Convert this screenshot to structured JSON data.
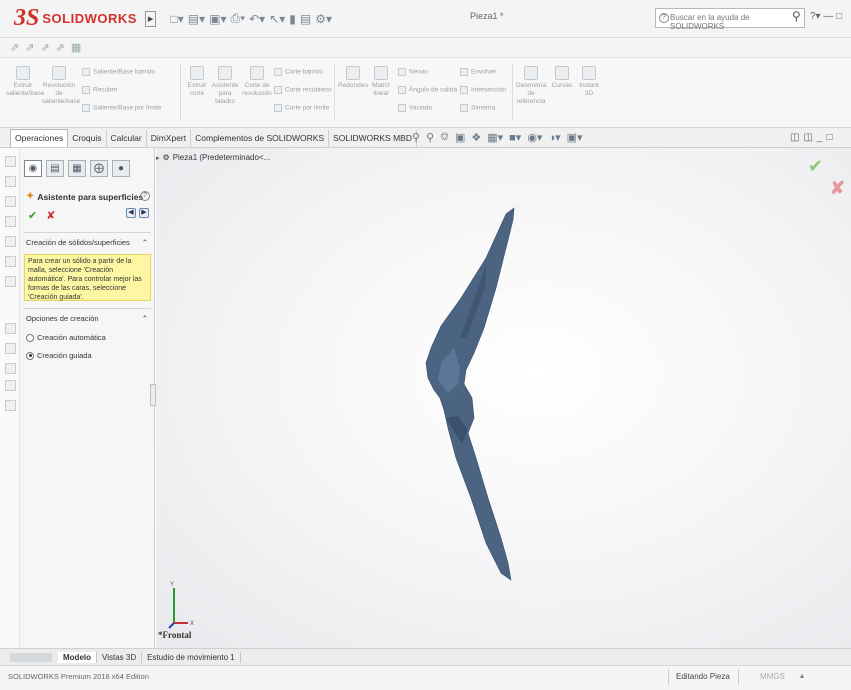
{
  "app": {
    "logo_ds": "3S",
    "logo_text": "SOLIDWORKS",
    "document_title": "Pieza1 *"
  },
  "help": {
    "search_placeholder": "Buscar en la ayuda de SOLIDWORKS"
  },
  "ribbon": {
    "items": {
      "extruir_saliente": "Extruir saliente/base",
      "revolucion_saliente": "Revolución de saliente/base",
      "saliente_barrido": "Saliente/Base barrido",
      "recubrir": "Recubrir",
      "saliente_limite": "Saliente/Base por límite",
      "extruir_corte": "Extruir corte",
      "asistente_taladro": "Asistente para taladro",
      "corte_revolucion": "Corte de revolución",
      "corte_barrido": "Corte barrido",
      "corte_recubierto": "Corte recubierto",
      "corte_limite": "Corte por límite",
      "redondeo": "Redondeo",
      "matriz_lineal": "Matriz lineal",
      "nervio": "Nervio",
      "angulo_salida": "Ángulo de salida",
      "vaciado": "Vaciado",
      "envolver": "Envolver",
      "interseccion": "Intersección",
      "simetria": "Simetría",
      "geometria_referencia": "Geometría de referencia",
      "curvas": "Curvas",
      "instant3d": "Instant 3D"
    }
  },
  "tabs": [
    {
      "label": "Operaciones"
    },
    {
      "label": "Croquis"
    },
    {
      "label": "Calcular"
    },
    {
      "label": "DimXpert"
    },
    {
      "label": "Complementos de SOLIDWORKS"
    },
    {
      "label": "SOLIDWORKS MBD"
    }
  ],
  "property_manager": {
    "title": "Asistente para superficies",
    "group1_title": "Creación de sólidos/superficies",
    "message": "Para crear un sólido a partir de la malla, seleccione 'Creación automática'. Para controlar mejor las formas de las caras, seleccione 'Creación guiada'.",
    "group2_title": "Opciones de creación",
    "option_auto": "Creación automática",
    "option_guided": "Creación guiada",
    "selected_option": "Creación guiada"
  },
  "viewport": {
    "tree_root": "Pieza1  (Predeterminado<...",
    "view_label": "*Frontal"
  },
  "bottom_tabs": [
    {
      "label": "Modelo"
    },
    {
      "label": "Vistas 3D"
    },
    {
      "label": "Estudio de movimiento 1"
    }
  ],
  "status": {
    "edition": "SOLIDWORKS Premium 2016 x64 Edition",
    "mode": "Editando Pieza",
    "units": "MMGS"
  },
  "colors": {
    "brand": "#d4302b",
    "model": "#4b6482",
    "message_bg": "#fdf7a4"
  }
}
